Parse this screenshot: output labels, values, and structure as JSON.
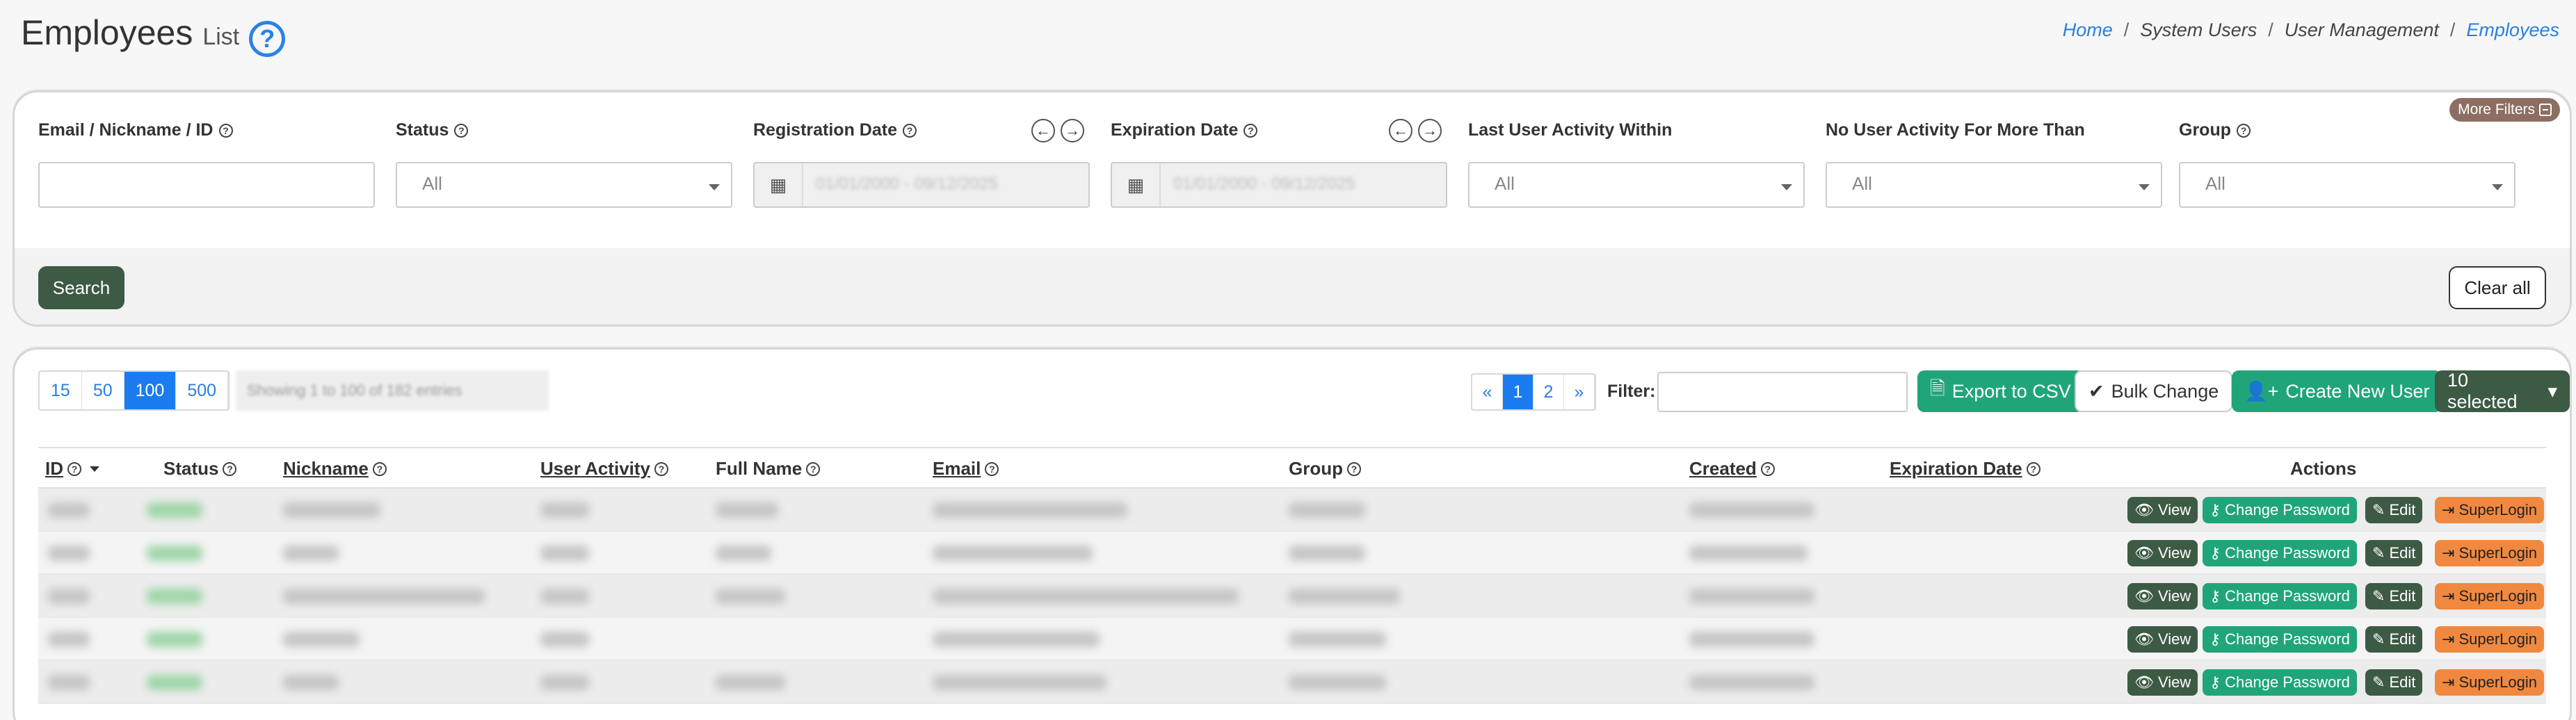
{
  "header": {
    "title": "Employees",
    "subtitle": "List",
    "help": "?"
  },
  "breadcrumb": [
    "Home",
    "System Users",
    "User Management",
    "Employees"
  ],
  "filters": {
    "more_filters": "More Filters",
    "email": {
      "label": "Email / Nickname / ID",
      "value": ""
    },
    "status": {
      "label": "Status",
      "value": "All"
    },
    "registration_date": {
      "label": "Registration Date",
      "value": "01/01/2000 - 09/12/2025"
    },
    "expiration_date": {
      "label": "Expiration Date",
      "value": "01/01/2000 - 09/12/2025"
    },
    "last_activity": {
      "label": "Last User Activity Within",
      "value": "All"
    },
    "no_activity": {
      "label": "No User Activity For More Than",
      "value": "All"
    },
    "group": {
      "label": "Group",
      "value": "All"
    },
    "search": "Search",
    "clear": "Clear all"
  },
  "toolbar": {
    "page_sizes": [
      "15",
      "50",
      "100",
      "500"
    ],
    "page_size_active": "100",
    "showing": "Showing 1 to 100 of 182 entries",
    "pages": [
      "«",
      "1",
      "2",
      "»"
    ],
    "filter_label": "Filter:",
    "export": "Export to CSV",
    "bulk": "Bulk Change",
    "create": "Create New User",
    "selected": "10 selected"
  },
  "table": {
    "columns": [
      "ID",
      "Status",
      "Nickname",
      "User Activity",
      "Full Name",
      "Email",
      "Group",
      "Created",
      "Expiration Date",
      "Actions"
    ],
    "actions": {
      "view": "View",
      "change_password": "Change Password",
      "edit": "Edit",
      "superlogin": "SuperLogin"
    },
    "row_count": 5
  },
  "colors": {
    "primary_dark": "#3d5a44",
    "success": "#20a57a",
    "accent_blue": "#1a7cf0",
    "warning": "#f0893f",
    "more_filters": "#8d6e63"
  }
}
